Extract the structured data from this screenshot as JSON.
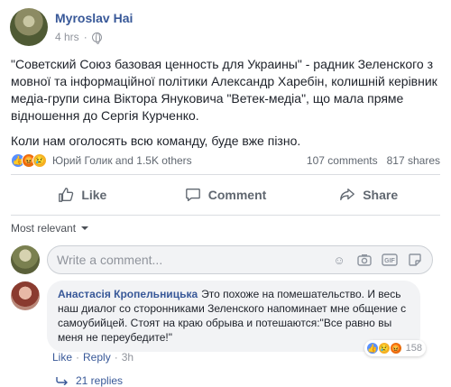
{
  "post": {
    "author": "Myroslav Hai",
    "time": "4 hrs",
    "privacy_icon": "globe-icon",
    "paragraphs": [
      "\"Советский Союз базовая ценность для Украины\" - радник Зеленского з мовної та інформаційної політики Александр Харебін, колишній керівник медіа-групи сина Віктора Януковича \"Ветек-медіа\", що мала пряме відношення до Сергія Курченко.",
      "Коли нам оголосять всю команду, буде вже пізно."
    ]
  },
  "stats": {
    "reaction_icons": [
      "like-icon",
      "angry-icon",
      "sad-icon"
    ],
    "reactors": "Юрий Голик and 1.5K others",
    "comments": "107 comments",
    "shares": "817 shares"
  },
  "actions": {
    "like": "Like",
    "comment": "Comment",
    "share": "Share"
  },
  "comments_header": {
    "sort": "Most relevant"
  },
  "composer": {
    "placeholder": "Write a comment...",
    "icons": [
      "emoji-icon",
      "camera-icon",
      "gif-icon",
      "sticker-icon"
    ]
  },
  "comment": {
    "author": "Анастасія Кропельницька",
    "text": "Это похоже на помешательство. И весь наш диалог со сторонниками Зеленского напоминает мне общение с самоубийцей. Стоят на краю обрыва и потешаются:\"Все равно вы меня не переубедите!\"",
    "reaction_count": "158",
    "like": "Like",
    "reply": "Reply",
    "time": "3h",
    "replies": "21 replies"
  },
  "colors": {
    "link": "#385898",
    "muted": "#90949c",
    "like_blue": "#5890ff"
  }
}
